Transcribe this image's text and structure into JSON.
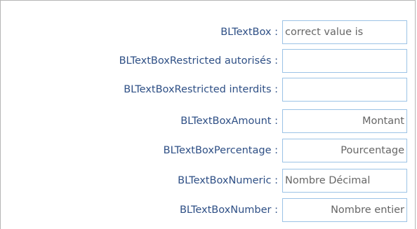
{
  "form": {
    "fields": [
      {
        "label": "BLTextBox :",
        "value": "correct value is",
        "placeholder": ""
      },
      {
        "label": "BLTextBoxRestricted autorisés :",
        "value": "",
        "placeholder": ""
      },
      {
        "label": "BLTextBoxRestricted interdits :",
        "value": "",
        "placeholder": ""
      },
      {
        "label": "BLTextBoxAmount :",
        "value": "",
        "placeholder": "Montant"
      },
      {
        "label": "BLTextBoxPercentage :",
        "value": "",
        "placeholder": "Pourcentage"
      },
      {
        "label": "BLTextBoxNumeric :",
        "value": "",
        "placeholder": "Nombre Décimal"
      },
      {
        "label": "BLTextBoxNumber :",
        "value": "",
        "placeholder": "Nombre entier"
      }
    ]
  },
  "colors": {
    "label_text": "#2e4f85",
    "input_border": "#9cc3e6",
    "placeholder_text": "#666666"
  }
}
